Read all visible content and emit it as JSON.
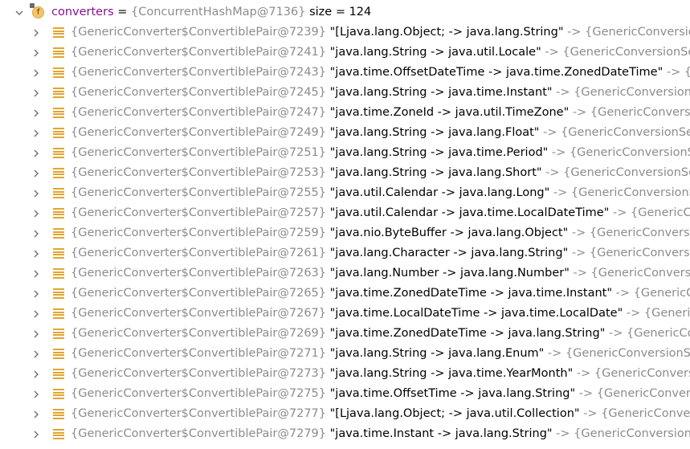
{
  "header": {
    "field_icon_letter": "f",
    "name": "converters",
    "equals": " = ",
    "type": "{ConcurrentHashMap@7136}",
    "size_text": "  size = 124"
  },
  "rows": [
    {
      "pair": "{GenericConverter$ConvertiblePair@7239}",
      "key": "\"[Ljava.lang.Object; -> java.lang.String\"",
      "arrow": " -> ",
      "value": "{GenericConversionS"
    },
    {
      "pair": "{GenericConverter$ConvertiblePair@7241}",
      "key": "\"java.lang.String -> java.util.Locale\"",
      "arrow": " -> ",
      "value": "{GenericConversionServ"
    },
    {
      "pair": "{GenericConverter$ConvertiblePair@7243}",
      "key": "\"java.time.OffsetDateTime -> java.time.ZonedDateTime\"",
      "arrow": " -> ",
      "value": "{GenericCo"
    },
    {
      "pair": "{GenericConverter$ConvertiblePair@7245}",
      "key": "\"java.lang.String -> java.time.Instant\"",
      "arrow": " -> ",
      "value": "{GenericConversionServ"
    },
    {
      "pair": "{GenericConverter$ConvertiblePair@7247}",
      "key": "\"java.time.ZoneId -> java.util.TimeZone\"",
      "arrow": " -> ",
      "value": "{GenericConversionSer"
    },
    {
      "pair": "{GenericConverter$ConvertiblePair@7249}",
      "key": "\"java.lang.String -> java.lang.Float\"",
      "arrow": " -> ",
      "value": "{GenericConversionServi"
    },
    {
      "pair": "{GenericConverter$ConvertiblePair@7251}",
      "key": "\"java.lang.String -> java.time.Period\"",
      "arrow": " -> ",
      "value": "{GenericConversionServi"
    },
    {
      "pair": "{GenericConverter$ConvertiblePair@7253}",
      "key": "\"java.lang.String -> java.lang.Short\"",
      "arrow": " -> ",
      "value": "{GenericConversionServi"
    },
    {
      "pair": "{GenericConverter$ConvertiblePair@7255}",
      "key": "\"java.util.Calendar -> java.lang.Long\"",
      "arrow": " -> ",
      "value": "{GenericConversionSer"
    },
    {
      "pair": "{GenericConverter$ConvertiblePair@7257}",
      "key": "\"java.util.Calendar -> java.time.LocalDateTime\"",
      "arrow": " -> ",
      "value": "{GenericConv"
    },
    {
      "pair": "{GenericConverter$ConvertiblePair@7259}",
      "key": "\"java.nio.ByteBuffer -> java.lang.Object\"",
      "arrow": " -> ",
      "value": "{GenericConversionSe"
    },
    {
      "pair": "{GenericConverter$ConvertiblePair@7261}",
      "key": "\"java.lang.Character -> java.lang.String\"",
      "arrow": " -> ",
      "value": "{GenericConversionS"
    },
    {
      "pair": "{GenericConverter$ConvertiblePair@7263}",
      "key": "\"java.lang.Number -> java.lang.Number\"",
      "arrow": " -> ",
      "value": "{GenericConversionSe"
    },
    {
      "pair": "{GenericConverter$ConvertiblePair@7265}",
      "key": "\"java.time.ZonedDateTime -> java.time.Instant\"",
      "arrow": " -> ",
      "value": "{GenericCon"
    },
    {
      "pair": "{GenericConverter$ConvertiblePair@7267}",
      "key": "\"java.time.LocalDateTime -> java.time.LocalDate\"",
      "arrow": " -> ",
      "value": "{GenericCo"
    },
    {
      "pair": "{GenericConverter$ConvertiblePair@7269}",
      "key": "\"java.time.ZonedDateTime -> java.lang.String\"",
      "arrow": " -> ",
      "value": "{GenericConv"
    },
    {
      "pair": "{GenericConverter$ConvertiblePair@7271}",
      "key": "\"java.lang.String -> java.lang.Enum\"",
      "arrow": " -> ",
      "value": "{GenericConversionServi"
    },
    {
      "pair": "{GenericConverter$ConvertiblePair@7273}",
      "key": "\"java.lang.String -> java.time.YearMonth\"",
      "arrow": " -> ",
      "value": "{GenericConversio"
    },
    {
      "pair": "{GenericConverter$ConvertiblePair@7275}",
      "key": "\"java.time.OffsetTime -> java.lang.String\"",
      "arrow": " -> ",
      "value": "{GenericConversio"
    },
    {
      "pair": "{GenericConverter$ConvertiblePair@7277}",
      "key": "\"[Ljava.lang.Object; -> java.util.Collection\"",
      "arrow": " -> ",
      "value": "{GenericConversi"
    },
    {
      "pair": "{GenericConverter$ConvertiblePair@7279}",
      "key": "\"java.time.Instant -> java.lang.String\"",
      "arrow": " -> ",
      "value": "{GenericConversionSe"
    }
  ],
  "colors": {
    "field_name": "#871094",
    "muted": "#8c8c8c",
    "list_icon": "#e2a532",
    "chevron": "#6e6e6e"
  },
  "icons": {
    "header_expand": "chevron-down-icon",
    "row_expand": "chevron-right-icon",
    "field": "field-icon",
    "entry": "map-entry-icon"
  }
}
